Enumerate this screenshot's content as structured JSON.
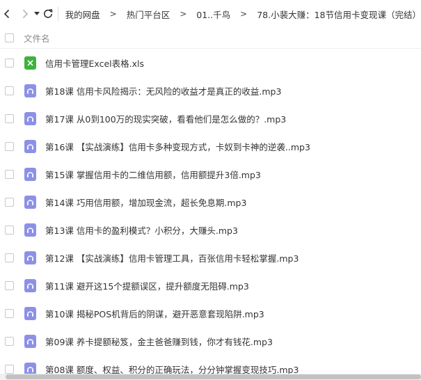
{
  "nav": {
    "back_icon": "chevron-left-icon",
    "forward_icon": "chevron-right-icon",
    "history_icon": "caret-down-icon",
    "refresh_icon": "refresh-icon"
  },
  "breadcrumb": [
    "我的网盘",
    "热门平台区",
    "01..千鸟",
    "78.小裴大赚：18节信用卡变现课（完结）"
  ],
  "breadcrumb_separator": ">",
  "file_list": {
    "column_header": "文件名",
    "files": [
      {
        "name": "信用卡管理Excel表格.xls",
        "icon": "excel-file-icon"
      },
      {
        "name": "第18课 信用卡风险揭示：无风险的收益才是真正的收益.mp3",
        "icon": "audio-file-icon"
      },
      {
        "name": "第17课 从0到100万的现实突破，看看他们是怎么做的？.mp3",
        "icon": "audio-file-icon"
      },
      {
        "name": "第16课 【实战演练】信用卡多种变现方式，卡奴到卡神的逆袭..mp3",
        "icon": "audio-file-icon"
      },
      {
        "name": "第15课 掌握信用卡的二维信用额，信用额提升3倍.mp3",
        "icon": "audio-file-icon"
      },
      {
        "name": "第14课 巧用信用额，增加现金流，超长免息期.mp3",
        "icon": "audio-file-icon"
      },
      {
        "name": "第13课 信用卡的盈利模式？小积分，大赚头.mp3",
        "icon": "audio-file-icon"
      },
      {
        "name": "第12课 【实战演练】信用卡管理工具，百张信用卡轻松掌握.mp3",
        "icon": "audio-file-icon"
      },
      {
        "name": "第11课 避开这15个提额误区，提升额度无阻碍.mp3",
        "icon": "audio-file-icon"
      },
      {
        "name": "第10课 揭秘POS机背后的阴谋，避开恶意套现陷阱.mp3",
        "icon": "audio-file-icon"
      },
      {
        "name": "第09课 养卡提额秘笈，金主爸爸赚到钱，你才有钱花.mp3",
        "icon": "audio-file-icon"
      },
      {
        "name": "第08课 额度、权益、积分的正确玩法，分分钟掌握变现技巧.mp3",
        "icon": "audio-file-icon"
      }
    ]
  },
  "colors": {
    "excel_icon": "#3cb33c",
    "audio_icon": "#8c91e6",
    "text": "#333333",
    "header_text": "#888888",
    "scrollbar_thumb": "#c2c2c2"
  }
}
